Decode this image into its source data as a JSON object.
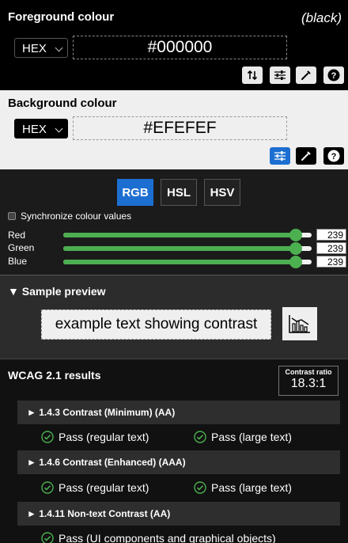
{
  "foreground": {
    "title": "Foreground colour",
    "color_name": "(black)",
    "format": "HEX",
    "value": "#000000"
  },
  "background": {
    "title": "Background colour",
    "format": "HEX",
    "value": "#EFEFEF"
  },
  "sliders": {
    "tabs": [
      "RGB",
      "HSL",
      "HSV"
    ],
    "active_tab": "RGB",
    "sync_label": "Synchronize colour values",
    "channels": [
      {
        "label": "Red",
        "value": "239",
        "level": 0.937
      },
      {
        "label": "Green",
        "value": "239",
        "level": 0.937
      },
      {
        "label": "Blue",
        "value": "239",
        "level": 0.937
      }
    ],
    "accent": "#4caf50"
  },
  "preview": {
    "title": "▼ Sample preview",
    "sample_text": "example text showing contrast"
  },
  "wcag": {
    "title": "WCAG 2.1 results",
    "ratio_label": "Contrast ratio",
    "ratio_value": "18.3:1",
    "criteria": [
      {
        "label": "► 1.4.3 Contrast (Minimum) (AA)",
        "results": [
          "Pass (regular text)",
          "Pass (large text)"
        ]
      },
      {
        "label": "► 1.4.6 Contrast (Enhanced) (AAA)",
        "results": [
          "Pass (regular text)",
          "Pass (large text)"
        ]
      },
      {
        "label": "► 1.4.11 Non-text Contrast (AA)",
        "results": [
          "Pass (UI components and graphical objects)"
        ]
      }
    ]
  }
}
